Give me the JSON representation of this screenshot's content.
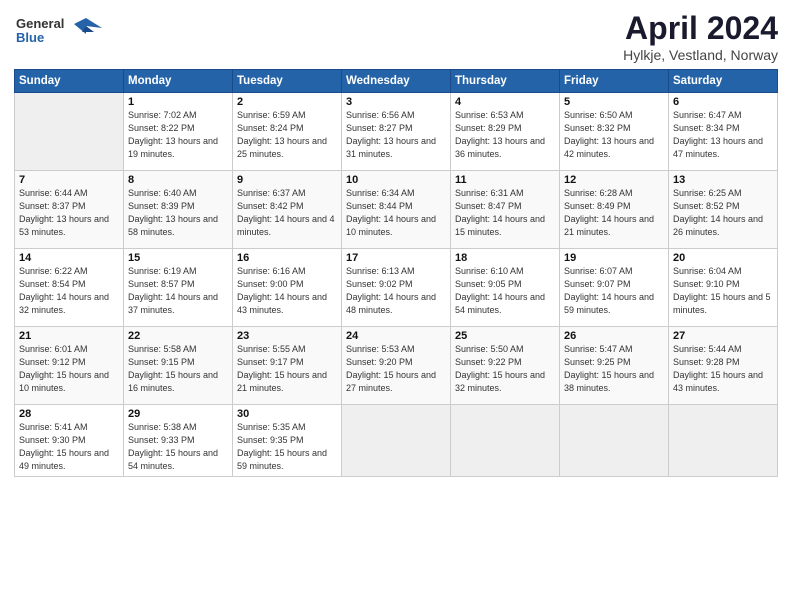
{
  "header": {
    "logo_line1": "General",
    "logo_line2": "Blue",
    "month": "April 2024",
    "location": "Hylkje, Vestland, Norway"
  },
  "days_of_week": [
    "Sunday",
    "Monday",
    "Tuesday",
    "Wednesday",
    "Thursday",
    "Friday",
    "Saturday"
  ],
  "weeks": [
    [
      {
        "day": "",
        "sunrise": "",
        "sunset": "",
        "daylight": ""
      },
      {
        "day": "1",
        "sunrise": "Sunrise: 7:02 AM",
        "sunset": "Sunset: 8:22 PM",
        "daylight": "Daylight: 13 hours and 19 minutes."
      },
      {
        "day": "2",
        "sunrise": "Sunrise: 6:59 AM",
        "sunset": "Sunset: 8:24 PM",
        "daylight": "Daylight: 13 hours and 25 minutes."
      },
      {
        "day": "3",
        "sunrise": "Sunrise: 6:56 AM",
        "sunset": "Sunset: 8:27 PM",
        "daylight": "Daylight: 13 hours and 31 minutes."
      },
      {
        "day": "4",
        "sunrise": "Sunrise: 6:53 AM",
        "sunset": "Sunset: 8:29 PM",
        "daylight": "Daylight: 13 hours and 36 minutes."
      },
      {
        "day": "5",
        "sunrise": "Sunrise: 6:50 AM",
        "sunset": "Sunset: 8:32 PM",
        "daylight": "Daylight: 13 hours and 42 minutes."
      },
      {
        "day": "6",
        "sunrise": "Sunrise: 6:47 AM",
        "sunset": "Sunset: 8:34 PM",
        "daylight": "Daylight: 13 hours and 47 minutes."
      }
    ],
    [
      {
        "day": "7",
        "sunrise": "Sunrise: 6:44 AM",
        "sunset": "Sunset: 8:37 PM",
        "daylight": "Daylight: 13 hours and 53 minutes."
      },
      {
        "day": "8",
        "sunrise": "Sunrise: 6:40 AM",
        "sunset": "Sunset: 8:39 PM",
        "daylight": "Daylight: 13 hours and 58 minutes."
      },
      {
        "day": "9",
        "sunrise": "Sunrise: 6:37 AM",
        "sunset": "Sunset: 8:42 PM",
        "daylight": "Daylight: 14 hours and 4 minutes."
      },
      {
        "day": "10",
        "sunrise": "Sunrise: 6:34 AM",
        "sunset": "Sunset: 8:44 PM",
        "daylight": "Daylight: 14 hours and 10 minutes."
      },
      {
        "day": "11",
        "sunrise": "Sunrise: 6:31 AM",
        "sunset": "Sunset: 8:47 PM",
        "daylight": "Daylight: 14 hours and 15 minutes."
      },
      {
        "day": "12",
        "sunrise": "Sunrise: 6:28 AM",
        "sunset": "Sunset: 8:49 PM",
        "daylight": "Daylight: 14 hours and 21 minutes."
      },
      {
        "day": "13",
        "sunrise": "Sunrise: 6:25 AM",
        "sunset": "Sunset: 8:52 PM",
        "daylight": "Daylight: 14 hours and 26 minutes."
      }
    ],
    [
      {
        "day": "14",
        "sunrise": "Sunrise: 6:22 AM",
        "sunset": "Sunset: 8:54 PM",
        "daylight": "Daylight: 14 hours and 32 minutes."
      },
      {
        "day": "15",
        "sunrise": "Sunrise: 6:19 AM",
        "sunset": "Sunset: 8:57 PM",
        "daylight": "Daylight: 14 hours and 37 minutes."
      },
      {
        "day": "16",
        "sunrise": "Sunrise: 6:16 AM",
        "sunset": "Sunset: 9:00 PM",
        "daylight": "Daylight: 14 hours and 43 minutes."
      },
      {
        "day": "17",
        "sunrise": "Sunrise: 6:13 AM",
        "sunset": "Sunset: 9:02 PM",
        "daylight": "Daylight: 14 hours and 48 minutes."
      },
      {
        "day": "18",
        "sunrise": "Sunrise: 6:10 AM",
        "sunset": "Sunset: 9:05 PM",
        "daylight": "Daylight: 14 hours and 54 minutes."
      },
      {
        "day": "19",
        "sunrise": "Sunrise: 6:07 AM",
        "sunset": "Sunset: 9:07 PM",
        "daylight": "Daylight: 14 hours and 59 minutes."
      },
      {
        "day": "20",
        "sunrise": "Sunrise: 6:04 AM",
        "sunset": "Sunset: 9:10 PM",
        "daylight": "Daylight: 15 hours and 5 minutes."
      }
    ],
    [
      {
        "day": "21",
        "sunrise": "Sunrise: 6:01 AM",
        "sunset": "Sunset: 9:12 PM",
        "daylight": "Daylight: 15 hours and 10 minutes."
      },
      {
        "day": "22",
        "sunrise": "Sunrise: 5:58 AM",
        "sunset": "Sunset: 9:15 PM",
        "daylight": "Daylight: 15 hours and 16 minutes."
      },
      {
        "day": "23",
        "sunrise": "Sunrise: 5:55 AM",
        "sunset": "Sunset: 9:17 PM",
        "daylight": "Daylight: 15 hours and 21 minutes."
      },
      {
        "day": "24",
        "sunrise": "Sunrise: 5:53 AM",
        "sunset": "Sunset: 9:20 PM",
        "daylight": "Daylight: 15 hours and 27 minutes."
      },
      {
        "day": "25",
        "sunrise": "Sunrise: 5:50 AM",
        "sunset": "Sunset: 9:22 PM",
        "daylight": "Daylight: 15 hours and 32 minutes."
      },
      {
        "day": "26",
        "sunrise": "Sunrise: 5:47 AM",
        "sunset": "Sunset: 9:25 PM",
        "daylight": "Daylight: 15 hours and 38 minutes."
      },
      {
        "day": "27",
        "sunrise": "Sunrise: 5:44 AM",
        "sunset": "Sunset: 9:28 PM",
        "daylight": "Daylight: 15 hours and 43 minutes."
      }
    ],
    [
      {
        "day": "28",
        "sunrise": "Sunrise: 5:41 AM",
        "sunset": "Sunset: 9:30 PM",
        "daylight": "Daylight: 15 hours and 49 minutes."
      },
      {
        "day": "29",
        "sunrise": "Sunrise: 5:38 AM",
        "sunset": "Sunset: 9:33 PM",
        "daylight": "Daylight: 15 hours and 54 minutes."
      },
      {
        "day": "30",
        "sunrise": "Sunrise: 5:35 AM",
        "sunset": "Sunset: 9:35 PM",
        "daylight": "Daylight: 15 hours and 59 minutes."
      },
      {
        "day": "",
        "sunrise": "",
        "sunset": "",
        "daylight": ""
      },
      {
        "day": "",
        "sunrise": "",
        "sunset": "",
        "daylight": ""
      },
      {
        "day": "",
        "sunrise": "",
        "sunset": "",
        "daylight": ""
      },
      {
        "day": "",
        "sunrise": "",
        "sunset": "",
        "daylight": ""
      }
    ]
  ]
}
